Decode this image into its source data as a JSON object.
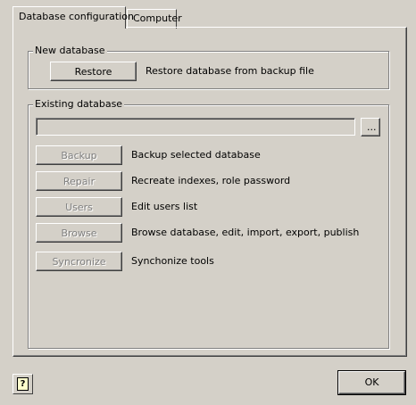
{
  "tabs": [
    {
      "label": "Database configuration",
      "active": true
    },
    {
      "label": "Computer",
      "active": false
    }
  ],
  "new_database": {
    "title": "New database",
    "restore_button": "Restore",
    "restore_description": "Restore database from backup file"
  },
  "existing_database": {
    "title": "Existing database",
    "path_value": "",
    "browse_button": "...",
    "actions": [
      {
        "button": "Backup",
        "description": "Backup selected database",
        "enabled": false
      },
      {
        "button": "Repair",
        "description": "Recreate indexes, role password",
        "enabled": false
      },
      {
        "button": "Users",
        "description": "Edit users list",
        "enabled": false
      },
      {
        "button": "Browse",
        "description": "Browse database, edit, import, export, publish",
        "enabled": false
      },
      {
        "button": "Syncronize",
        "description": "Synchonize tools",
        "enabled": false
      }
    ]
  },
  "footer": {
    "help_icon": "help-icon",
    "ok_button": "OK"
  },
  "colors": {
    "face": "#d4d0c8",
    "highlight": "#ffffff",
    "shadow": "#808080",
    "dark_shadow": "#404040",
    "disabled_text": "#808080"
  }
}
